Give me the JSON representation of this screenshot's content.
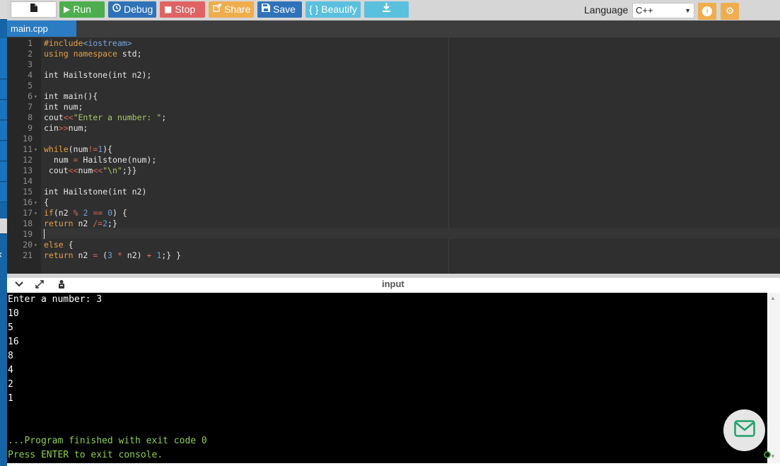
{
  "toolbar": {
    "run_label": "Run",
    "debug_label": "Debug",
    "stop_label": "Stop",
    "share_label": "Share",
    "save_label": "Save",
    "beautify_label": "{ } Beautify",
    "language_label": "Language",
    "language_value": "C++"
  },
  "tabs": [
    {
      "label": "main.cpp",
      "active": true
    }
  ],
  "editor": {
    "lines": [
      {
        "n": "1",
        "text": "#include<iostream>"
      },
      {
        "n": "2",
        "text": "using namespace std;"
      },
      {
        "n": "3",
        "text": ""
      },
      {
        "n": "4",
        "text": "int Hailstone(int n2);"
      },
      {
        "n": "5",
        "text": ""
      },
      {
        "n": "6",
        "text": "int main(){"
      },
      {
        "n": "7",
        "text": "int num;"
      },
      {
        "n": "8",
        "text": "cout<<\"Enter a number: \";"
      },
      {
        "n": "9",
        "text": "cin>>num;"
      },
      {
        "n": "10",
        "text": ""
      },
      {
        "n": "11",
        "text": "while(num!=1){"
      },
      {
        "n": "12",
        "text": "  num = Hailstone(num);"
      },
      {
        "n": "13",
        "text": " cout<<num<<\"\\n\";}}"
      },
      {
        "n": "14",
        "text": ""
      },
      {
        "n": "15",
        "text": "int Hailstone(int n2)"
      },
      {
        "n": "16",
        "text": "{"
      },
      {
        "n": "17",
        "text": "if(n2 % 2 == 0) {"
      },
      {
        "n": "18",
        "text": "return n2 /=2;}"
      },
      {
        "n": "19",
        "text": ""
      },
      {
        "n": "20",
        "text": "else {"
      },
      {
        "n": "21",
        "text": "return n2 = (3 * n2) + 1;} }"
      }
    ]
  },
  "console": {
    "title": "input",
    "output": [
      {
        "text": "Enter a number: 3",
        "color": "#ffffff"
      },
      {
        "text": "10",
        "color": "#ffffff"
      },
      {
        "text": "5",
        "color": "#ffffff"
      },
      {
        "text": "16",
        "color": "#ffffff"
      },
      {
        "text": "8",
        "color": "#ffffff"
      },
      {
        "text": "4",
        "color": "#ffffff"
      },
      {
        "text": "2",
        "color": "#ffffff"
      },
      {
        "text": "1",
        "color": "#ffffff"
      }
    ],
    "finished": "...Program finished with exit code 0",
    "press_enter": "Press ENTER to exit console."
  },
  "icons": {
    "new_file": "file-icon",
    "run": "play-icon",
    "debug": "debug-icon",
    "stop": "stop-icon",
    "share": "share-icon",
    "save": "save-icon",
    "download": "download-icon",
    "info": "info-icon",
    "settings": "gear-icon",
    "mail": "mail-icon"
  },
  "colors": {
    "run": "#4cae4c",
    "debug": "#2f72b8",
    "stop": "#e06363",
    "share": "#f0ad4e",
    "save": "#2f72b8",
    "beautify": "#5bc0de",
    "tab_active": "#2b7cc2",
    "console_green": "#8fce4a"
  }
}
